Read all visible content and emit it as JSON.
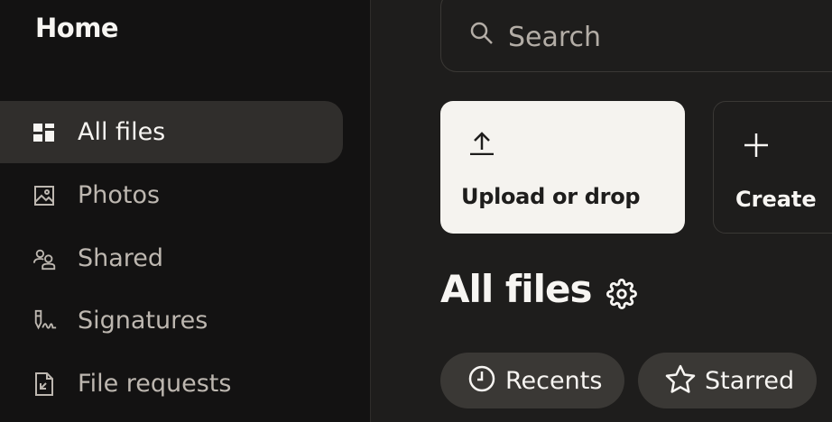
{
  "sidebar": {
    "title": "Home",
    "items": [
      {
        "label": "All files",
        "icon": "all-files-icon",
        "active": true
      },
      {
        "label": "Photos",
        "icon": "photos-icon"
      },
      {
        "label": "Shared",
        "icon": "shared-icon"
      },
      {
        "label": "Signatures",
        "icon": "signatures-icon"
      },
      {
        "label": "File requests",
        "icon": "file-requests-icon"
      }
    ]
  },
  "search": {
    "placeholder": "Search",
    "icon": "search-icon"
  },
  "actions": {
    "upload": {
      "label": "Upload or drop",
      "icon": "upload-icon"
    },
    "create": {
      "label": "Create",
      "icon": "plus-icon"
    }
  },
  "main": {
    "title": "All files",
    "settings_icon": "gear-icon",
    "filters": [
      {
        "label": "Recents",
        "icon": "clock-icon"
      },
      {
        "label": "Starred",
        "icon": "star-icon"
      }
    ]
  },
  "colors": {
    "sidebar_bg": "#131212",
    "main_bg": "#1e1d1c",
    "active_item_bg": "#302e2c",
    "upload_card_bg": "#f5f3ef",
    "chip_bg": "#3a3835",
    "text_primary": "#f7f5f2",
    "text_muted": "#bdb7b0"
  }
}
